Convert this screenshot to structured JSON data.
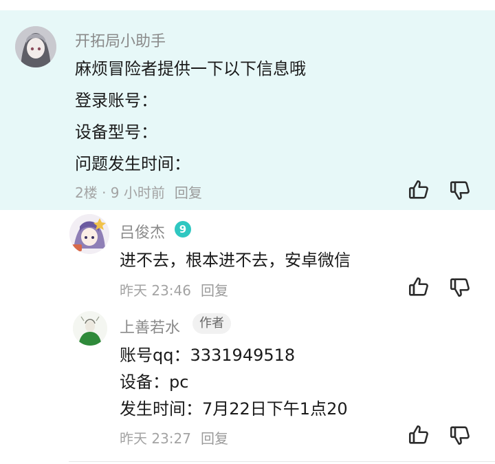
{
  "main_comment": {
    "author": "开拓局小助手",
    "lines": [
      "麻烦冒险者提供一下以下信息哦",
      "登录账号：",
      "设备型号：",
      "问题发生时间："
    ],
    "floor_time": "2楼 · 9 小时前",
    "reply_label": "回复"
  },
  "replies": [
    {
      "author": "吕俊杰",
      "level": "9",
      "lines": [
        "进不去，根本进不去，安卓微信"
      ],
      "time": "昨天 23:46",
      "reply_label": "回复"
    },
    {
      "author": "上善若水",
      "tag": "作者",
      "lines": [
        "账号qq：3331949518",
        "设备：pc",
        "发生时间：7月22日下午1点20"
      ],
      "time": "昨天 23:27",
      "reply_label": "回复"
    }
  ],
  "icons": {
    "like": "thumbs-up-icon",
    "dislike": "thumbs-down-icon"
  },
  "colors": {
    "highlight_bg": "#e7f8f8",
    "level_badge": "#2fc7c1",
    "meta_text": "#a3a3a3"
  }
}
